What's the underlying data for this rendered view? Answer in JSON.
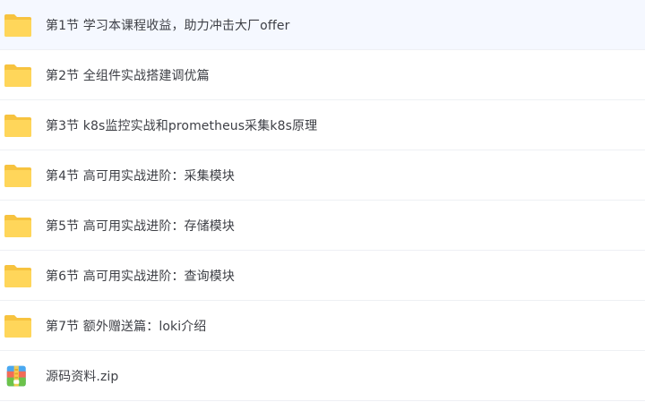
{
  "files": [
    {
      "name": "第1节 学习本课程收益，助力冲击大厂offer",
      "type": "folder",
      "icon": "folder-icon"
    },
    {
      "name": "第2节 全组件实战搭建调优篇",
      "type": "folder",
      "icon": "folder-icon"
    },
    {
      "name": "第3节 k8s监控实战和prometheus采集k8s原理",
      "type": "folder",
      "icon": "folder-icon"
    },
    {
      "name": "第4节 高可用实战进阶：采集模块",
      "type": "folder",
      "icon": "folder-icon"
    },
    {
      "name": "第5节 高可用实战进阶：存储模块",
      "type": "folder",
      "icon": "folder-icon"
    },
    {
      "name": "第6节 高可用实战进阶：查询模块",
      "type": "folder",
      "icon": "folder-icon"
    },
    {
      "name": "第7节 额外赠送篇：loki介绍",
      "type": "folder",
      "icon": "folder-icon"
    },
    {
      "name": "源码资料.zip",
      "type": "zip",
      "icon": "zip-archive-icon"
    }
  ],
  "colors": {
    "folder_back": "#f7c33f",
    "folder_front": "#ffd65a",
    "zip_red": "#f36b56",
    "zip_blue": "#4aa8f0",
    "zip_green": "#6cc24a",
    "zip_yellow": "#ffcf4d"
  }
}
